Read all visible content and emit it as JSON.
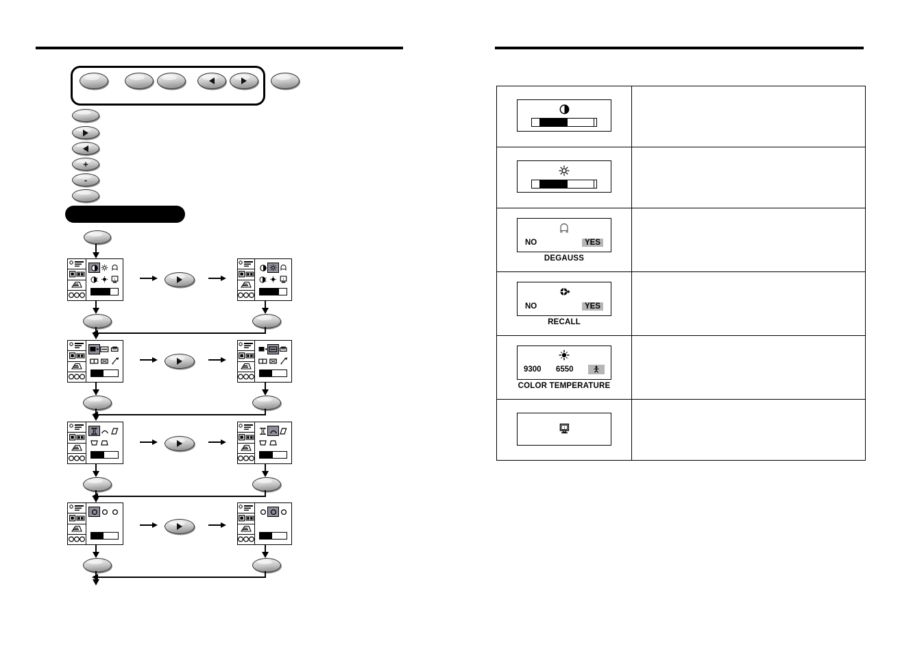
{
  "document": {
    "type": "monitor-user-manual-spread",
    "left_page": {
      "rule": true,
      "control_panel": {
        "name": "front-control-panel",
        "buttons": [
          {
            "id": "btn-1",
            "glyph": "oval-blank"
          },
          {
            "id": "btn-2",
            "glyph": "oval-blank"
          },
          {
            "id": "btn-3",
            "glyph": "oval-blank"
          },
          {
            "id": "btn-left",
            "glyph": "triangle-left"
          },
          {
            "id": "btn-right",
            "glyph": "triangle-right"
          },
          {
            "id": "btn-6",
            "glyph": "oval-blank"
          }
        ]
      },
      "button_legend": [
        {
          "id": "legend-1",
          "glyph": "oval-blank",
          "label": ""
        },
        {
          "id": "legend-2",
          "glyph": "triangle-right",
          "label": ""
        },
        {
          "id": "legend-3",
          "glyph": "triangle-left",
          "label": ""
        },
        {
          "id": "legend-4",
          "glyph": "plus",
          "label": "+"
        },
        {
          "id": "legend-5",
          "glyph": "minus",
          "label": "-"
        },
        {
          "id": "legend-6",
          "glyph": "oval-blank",
          "label": ""
        }
      ],
      "section_heading_bar": {
        "redacted": true,
        "label": ""
      },
      "entry_button": {
        "glyph": "oval-blank",
        "label": ""
      },
      "flow": {
        "nav_button_glyph": "triangle-right",
        "steps": [
          {
            "id": "flow-step-1",
            "category_index": 0,
            "left_menu": {
              "selected_icon": 0,
              "icons": [
                "contrast",
                "brightness",
                "degauss",
                "volume",
                "brightness-small",
                "info-monitor"
              ],
              "slider_fill_pct": 72
            },
            "right_menu": {
              "selected_icon": 1,
              "icons": [
                "contrast",
                "brightness",
                "degauss",
                "volume",
                "brightness-small",
                "info-monitor"
              ],
              "slider_fill_pct": 72
            }
          },
          {
            "id": "flow-step-2",
            "category_index": 1,
            "left_menu": {
              "selected_icon": 0,
              "icons": [
                "h-position",
                "v-size",
                "h-size",
                "h-width",
                "v-center",
                "zoom-moire"
              ],
              "slider_fill_pct": 45
            },
            "right_menu": {
              "selected_icon": 1,
              "icons": [
                "h-position",
                "v-size",
                "h-size",
                "h-width",
                "v-center",
                "zoom-moire"
              ],
              "slider_fill_pct": 45
            }
          },
          {
            "id": "flow-step-3",
            "category_index": 2,
            "left_menu": {
              "selected_icon": 0,
              "icons": [
                "pincushion",
                "pin-balance",
                "parallelogram",
                "trapezoid",
                "rotation"
              ],
              "slider_fill_pct": 48
            },
            "right_menu": {
              "selected_icon": 1,
              "icons": [
                "pincushion",
                "pin-balance",
                "parallelogram",
                "trapezoid",
                "rotation"
              ],
              "slider_fill_pct": 48
            }
          },
          {
            "id": "flow-step-4",
            "category_index": 3,
            "left_menu": {
              "selected_icon": 0,
              "icons": [
                "circle-red",
                "circle-green",
                "circle-blue"
              ],
              "slider_fill_pct": 45
            },
            "right_menu": {
              "selected_icon": 1,
              "icons": [
                "circle-red",
                "circle-green",
                "circle-blue"
              ],
              "slider_fill_pct": 45
            }
          }
        ],
        "exit_button_glyph": "oval-blank"
      }
    },
    "right_page": {
      "rule": true,
      "table": {
        "rows": [
          {
            "id": "row-contrast",
            "osd": {
              "kind": "slider",
              "symbol": "contrast",
              "label": "",
              "fill_pct": 55,
              "lead_pct": 12
            },
            "description": ""
          },
          {
            "id": "row-brightness",
            "osd": {
              "kind": "slider",
              "symbol": "brightness",
              "label": "",
              "fill_pct": 55,
              "lead_pct": 12
            },
            "description": ""
          },
          {
            "id": "row-degauss",
            "osd": {
              "kind": "yesno",
              "symbol": "degauss",
              "label": "DEGAUSS",
              "no": "NO",
              "yes": "YES",
              "selected": "YES"
            },
            "description": ""
          },
          {
            "id": "row-recall",
            "osd": {
              "kind": "yesno",
              "symbol": "recall",
              "label": "RECALL",
              "no": "NO",
              "yes": "YES",
              "selected": "YES"
            },
            "description": ""
          },
          {
            "id": "row-color-temperature",
            "osd": {
              "kind": "colortemp",
              "symbol": "color-temp",
              "label": "COLOR TEMPERATURE",
              "options": [
                "9300",
                "6550"
              ],
              "user_option": "user-icon",
              "selected": "user-icon"
            },
            "description": ""
          },
          {
            "id": "row-information",
            "osd": {
              "kind": "symbol-only",
              "symbol": "info-monitor",
              "label": ""
            },
            "description": ""
          }
        ]
      }
    }
  },
  "colors": {
    "ink": "#000000",
    "paper": "#ffffff",
    "highlight": "#b6b6b6",
    "osd_select": "#8e8e99",
    "button_face": "#c8c8c8"
  }
}
